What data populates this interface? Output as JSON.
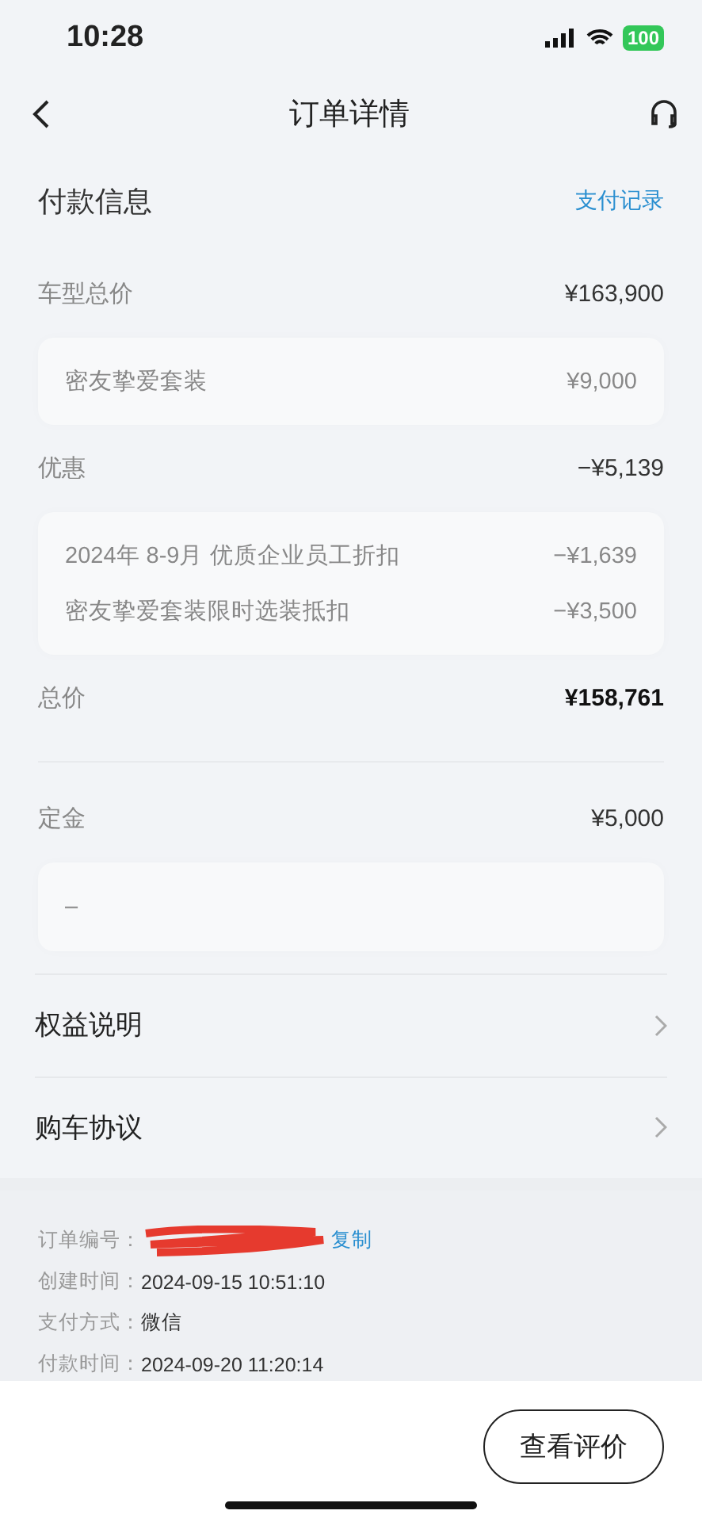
{
  "status_bar": {
    "time": "10:28",
    "battery": "100"
  },
  "nav": {
    "title": "订单详情"
  },
  "payment": {
    "title": "付款信息",
    "link": "支付记录",
    "rows": [
      {
        "kind": "row",
        "label": "车型总价",
        "value": "¥163,900",
        "bold": false
      },
      {
        "kind": "card",
        "items": [
          {
            "label": "密友挚爱套装",
            "value": "¥9,000"
          }
        ]
      },
      {
        "kind": "row",
        "label": "优惠",
        "value": "−¥5,139",
        "bold": false
      },
      {
        "kind": "card",
        "items": [
          {
            "label": "2024年 8-9月 优质企业员工折扣",
            "value": "−¥1,639"
          },
          {
            "label": "密友挚爱套装限时选装抵扣",
            "value": "−¥3,500"
          }
        ]
      },
      {
        "kind": "row",
        "label": "总价",
        "value": "¥158,761",
        "bold": true
      },
      {
        "kind": "divider"
      },
      {
        "kind": "row",
        "label": "定金",
        "value": "¥5,000",
        "bold": false
      },
      {
        "kind": "card",
        "items": [
          {
            "label": "–"
          }
        ]
      }
    ]
  },
  "links": [
    {
      "label": "权益说明"
    },
    {
      "label": "购车协议"
    }
  ],
  "order_info": [
    {
      "label": "订单编号：",
      "value_redacted": true,
      "action": "复制"
    },
    {
      "label": "创建时间：",
      "value": "2024-09-15 10:51:10"
    },
    {
      "label": "支付方式：",
      "value": "微信"
    },
    {
      "label": "付款时间：",
      "value": "2024-09-20 11:20:14"
    }
  ],
  "bottom_button": "查看评价"
}
